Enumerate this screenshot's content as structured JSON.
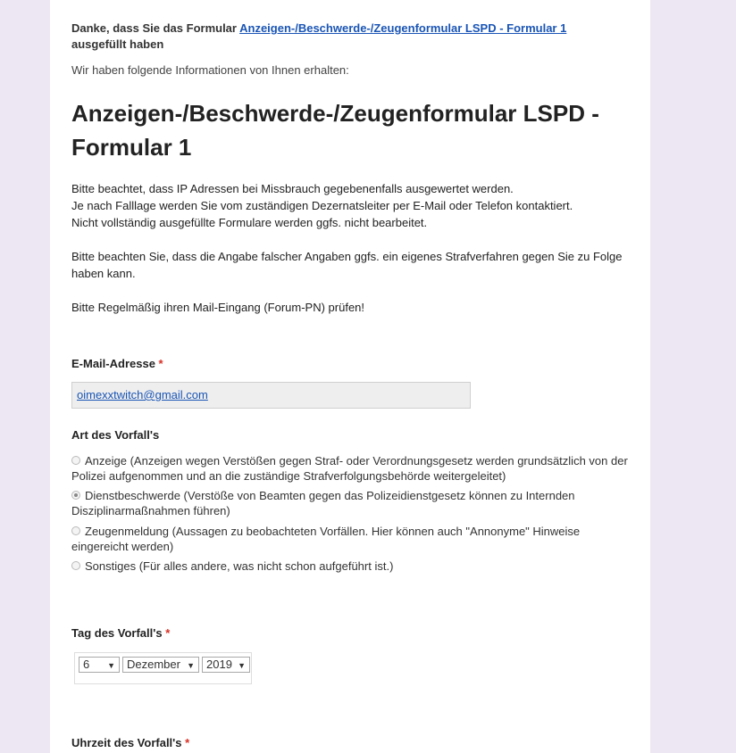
{
  "confirmation": {
    "prefix": "Danke, dass Sie das Formular",
    "form_link": "Anzeigen-/Beschwerde-/Zeugenformular LSPD - Formular 1",
    "suffix": "ausgefüllt haben",
    "received": "Wir haben folgende Informationen von Ihnen erhalten:"
  },
  "form": {
    "title": "Anzeigen-/Beschwerde-/Zeugenformular LSPD - Formular 1",
    "description": {
      "line1": "Bitte beachtet, dass IP Adressen bei Missbrauch gegebenenfalls ausgewertet werden.",
      "line2": "Je nach Falllage werden Sie vom zuständigen Dezernatsleiter per E-Mail oder Telefon kontaktiert.",
      "line3": "Nicht vollständig ausgefüllte Formulare werden ggfs. nicht bearbeitet.",
      "para2": "Bitte beachten Sie, dass die Angabe falscher Angaben ggfs. ein eigenes Strafverfahren gegen Sie zu Folge haben kann.",
      "para3": "Bitte Regelmäßig ihren Mail-Eingang (Forum-PN) prüfen!"
    }
  },
  "fields": {
    "email": {
      "label": "E-Mail-Adresse",
      "required_mark": "*",
      "value": "oimexxtwitch@gmail.com"
    },
    "incident_type": {
      "label": "Art des Vorfall's",
      "options": [
        {
          "label": "Anzeige (Anzeigen wegen Verstößen gegen Straf- oder Verordnungsgesetz werden grundsätzlich von der Polizei aufgenommen und an die zuständige Strafverfolgungsbehörde weitergeleitet)",
          "selected": false
        },
        {
          "label": "Dienstbeschwerde (Verstöße von Beamten gegen das Polizeidienstgesetz können zu Internden Disziplinarmaßnahmen führen)",
          "selected": true
        },
        {
          "label": "Zeugenmeldung (Aussagen zu beobachteten Vorfällen. Hier können auch \"Annonyme\" Hinweise eingereicht werden)",
          "selected": false
        },
        {
          "label": "Sonstiges (Für alles andere, was nicht schon aufgeführt ist.)",
          "selected": false
        }
      ]
    },
    "incident_date": {
      "label": "Tag des Vorfall's",
      "required_mark": "*",
      "day": "6",
      "month": "Dezember",
      "year": "2019"
    },
    "incident_time": {
      "label": "Uhrzeit des Vorfall's",
      "required_mark": "*"
    }
  },
  "icons": {
    "select_arrow": "chevron-down-icon"
  }
}
